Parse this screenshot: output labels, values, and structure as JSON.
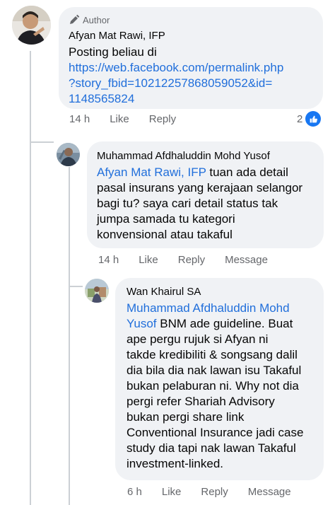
{
  "comment1": {
    "badge_label": "Author",
    "author": "Afyan Mat Rawi, IFP",
    "text_lines": [
      "Posting beliau di"
    ],
    "link_lines": [
      "https://web.facebook.com/permalink.php",
      "?story_fbid=10212257868059052&id=",
      "1148565824"
    ],
    "time": "14 h",
    "like_label": "Like",
    "reply_label": "Reply",
    "reaction_count": "2",
    "reaction_icon": "thumbs-up-icon"
  },
  "comment2": {
    "author": "Muhammad Afdhaluddin Mohd Yusof",
    "mention": "Afyan Mat Rawi, IFP",
    "line1_rest": " tuan ada detail",
    "lines": [
      "pasal insurans yang kerajaan selangor",
      "bagi tu? saya cari detail status tak",
      "jumpa samada tu kategori",
      "konvensional atau takaful"
    ],
    "time": "14 h",
    "like_label": "Like",
    "reply_label": "Reply",
    "message_label": "Message"
  },
  "comment3": {
    "author": "Wan Khairul SA",
    "mention_line1": "Muhammad Afdhaluddin Mohd",
    "mention_line2": "Yusof",
    "line2_rest": " BNM ade guideline. Buat",
    "lines": [
      "ape pergu rujuk si Afyan ni",
      "takde kredibiliti & songsang dalil",
      "dia bila dia nak lawan isu Takaful",
      "bukan pelaburan ni. Why not dia",
      "pergi refer Shariah Advisory",
      "bukan pergi share link",
      "Conventional Insurance jadi case",
      "study dia tapi nak lawan Takaful",
      "investment-linked."
    ],
    "time": "6 h",
    "like_label": "Like",
    "reply_label": "Reply",
    "message_label": "Message"
  },
  "colors": {
    "link": "#216fdb",
    "bubble": "#f0f2f5",
    "meta": "#65676b",
    "like_badge": "#1877f2"
  }
}
